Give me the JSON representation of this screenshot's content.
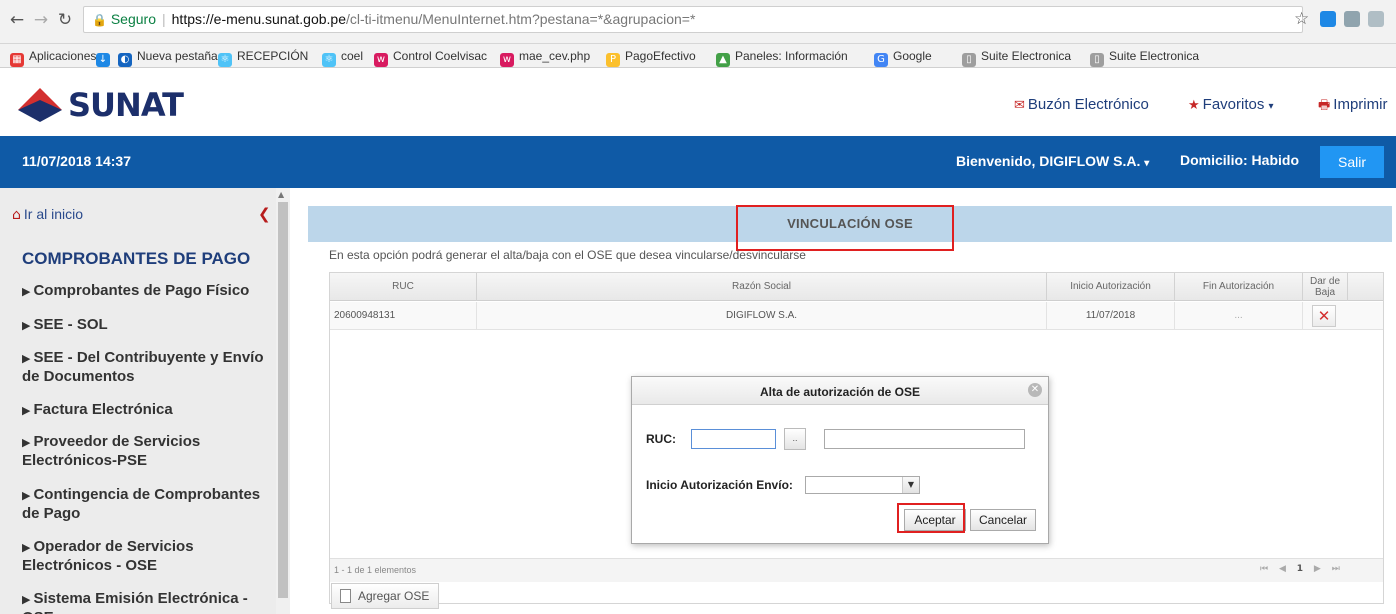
{
  "browser": {
    "address": {
      "secure_label": "Seguro",
      "host": "https://e-menu.sunat.gob.pe",
      "path": "/cl-ti-itmenu/MenuInternet.htm?pestana=*&agrupacion=*"
    },
    "bookmarks": [
      {
        "label": "Aplicaciones",
        "icon": "apps-grid-icon",
        "color": "#e53935"
      },
      {
        "label": "",
        "icon": "download-icon",
        "color": "#1e88e5"
      },
      {
        "label": "Nueva pestaña",
        "icon": "browser-extension-icon",
        "color": "#1565c0"
      },
      {
        "label": "RECEPCIÓN",
        "icon": "react-icon",
        "color": "#4fc3f7"
      },
      {
        "label": "coel",
        "icon": "react-icon",
        "color": "#4fc3f7"
      },
      {
        "label": "Control Coelvisac",
        "icon": "web-icon",
        "color": "#d81b60"
      },
      {
        "label": "mae_cev.php",
        "icon": "web-icon",
        "color": "#d81b60"
      },
      {
        "label": "PagoEfectivo",
        "icon": "pagoefectivo-icon",
        "color": "#fbc02d"
      },
      {
        "label": "Paneles: Información",
        "icon": "chart-icon",
        "color": "#43a047"
      },
      {
        "label": "Google",
        "icon": "google-icon",
        "color": "#4285f4"
      },
      {
        "label": "Suite Electronica",
        "icon": "page-icon",
        "color": "#9e9e9e"
      },
      {
        "label": "Suite Electronica",
        "icon": "page-icon",
        "color": "#9e9e9e"
      }
    ]
  },
  "header": {
    "logo_text": "SUNAT",
    "buzon": "Buzón Electrónico",
    "favoritos": "Favoritos",
    "imprimir": "Imprimir"
  },
  "userbar": {
    "datetime": "11/07/2018 14:37",
    "welcome": "Bienvenido, DIGIFLOW S.A.",
    "domicilio": "Domicilio: Habido",
    "salir": "Salir"
  },
  "sidebar": {
    "home": "Ir al inicio",
    "title": "COMPROBANTES DE PAGO",
    "items": [
      "Comprobantes de Pago Físico",
      "SEE - SOL",
      "SEE - Del Contribuyente y Envío de Documentos",
      "Factura Electrónica",
      "Proveedor de Servicios Electrónicos-PSE",
      "Contingencia de Comprobantes de Pago",
      "Operador de Servicios Electrónicos - OSE",
      "Sistema Emisión Electrónica - OSE"
    ]
  },
  "main": {
    "title": "VINCULACIÓN OSE",
    "description": "En esta opción podrá generar el alta/baja con el OSE que desea vincularse/desvincularse",
    "grid": {
      "columns": [
        "RUC",
        "Razón Social",
        "Inicio Autorización",
        "Fin Autorización",
        "Dar de Baja"
      ],
      "rows": [
        {
          "ruc": "20600948131",
          "razon_social": "DIGIFLOW S.A.",
          "inicio": "11/07/2018",
          "fin": "..."
        }
      ],
      "paging_info": "1 - 1 de 1 elementos",
      "current_page": "1"
    },
    "add_button": "Agregar OSE"
  },
  "modal": {
    "title": "Alta de autorización de OSE",
    "ruc_label": "RUC:",
    "ruc_value": "",
    "lookup_label": "..",
    "razon_value": "",
    "inicio_label": "Inicio Autorización Envío:",
    "inicio_selected": "",
    "accept": "Aceptar",
    "cancel": "Cancelar"
  },
  "colors": {
    "brand_blue": "#0f5aa6",
    "salir_button": "#2196f3",
    "title_bar": "#bcd6ea",
    "highlight": "#e02020",
    "logo": "#1c2f6b"
  }
}
